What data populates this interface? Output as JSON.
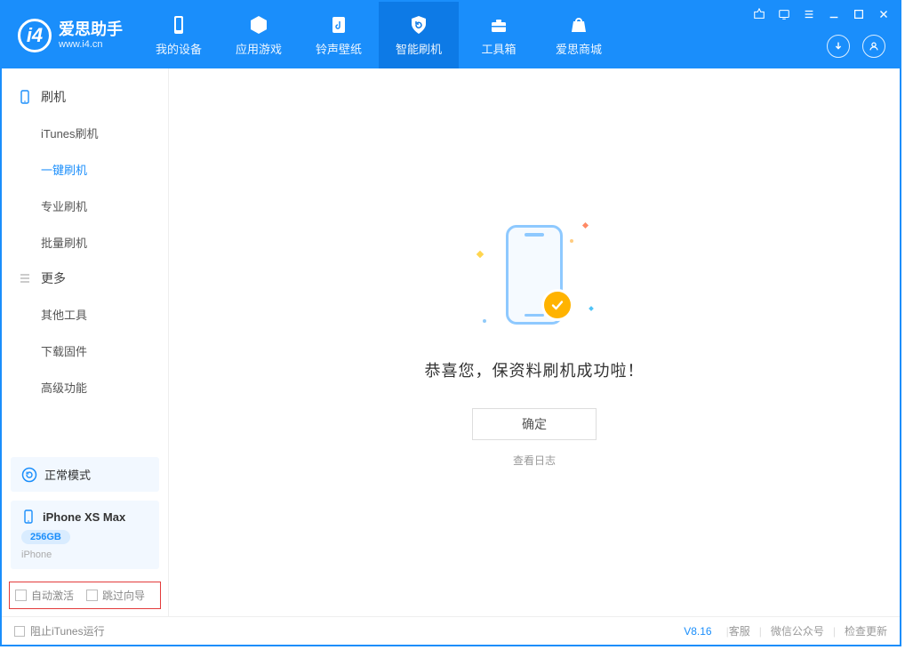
{
  "app": {
    "name_cn": "爱思助手",
    "url": "www.i4.cn"
  },
  "header_tabs": [
    {
      "label": "我的设备"
    },
    {
      "label": "应用游戏"
    },
    {
      "label": "铃声壁纸"
    },
    {
      "label": "智能刷机"
    },
    {
      "label": "工具箱"
    },
    {
      "label": "爱思商城"
    }
  ],
  "sidebar": {
    "group_flash": "刷机",
    "items_flash": [
      {
        "label": "iTunes刷机"
      },
      {
        "label": "一键刷机"
      },
      {
        "label": "专业刷机"
      },
      {
        "label": "批量刷机"
      }
    ],
    "group_more": "更多",
    "items_more": [
      {
        "label": "其他工具"
      },
      {
        "label": "下载固件"
      },
      {
        "label": "高级功能"
      }
    ]
  },
  "mode": {
    "label": "正常模式"
  },
  "device": {
    "name": "iPhone XS Max",
    "storage": "256GB",
    "type": "iPhone"
  },
  "options": {
    "auto_activate": "自动激活",
    "skip_guide": "跳过向导"
  },
  "main": {
    "success_text": "恭喜您，保资料刷机成功啦！",
    "ok_label": "确定",
    "view_log": "查看日志"
  },
  "footer": {
    "block_itunes": "阻止iTunes运行",
    "version": "V8.16",
    "links": [
      "客服",
      "微信公众号",
      "检查更新"
    ]
  }
}
